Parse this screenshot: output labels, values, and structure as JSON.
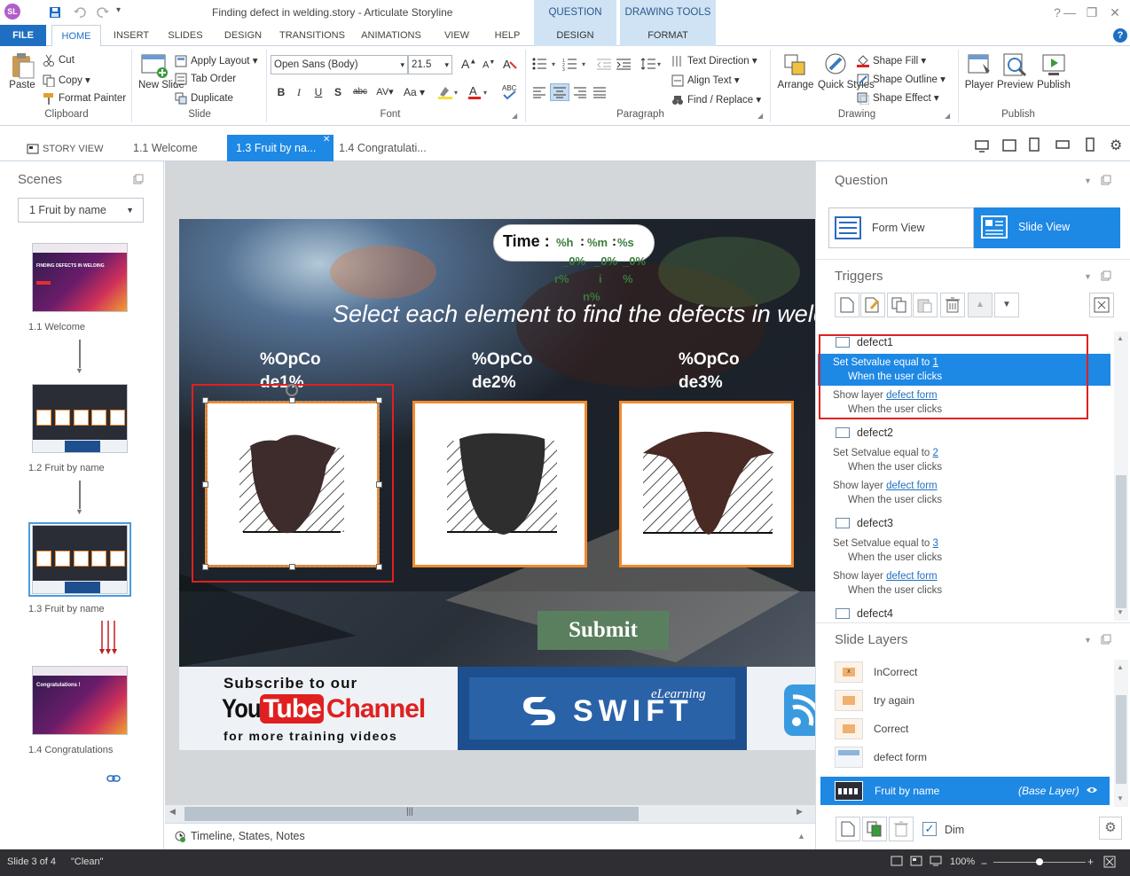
{
  "window": {
    "logo": "SL",
    "title": "Finding defect in welding.story - Articulate Storyline",
    "context_tabs": [
      "QUESTION TOOLS",
      "DRAWING TOOLS"
    ]
  },
  "ribbon_tabs": [
    "FILE",
    "HOME",
    "INSERT",
    "SLIDES",
    "DESIGN",
    "TRANSITIONS",
    "ANIMATIONS",
    "VIEW",
    "HELP",
    "DESIGN",
    "FORMAT"
  ],
  "clipboard": {
    "paste": "Paste",
    "cut": "Cut",
    "copy": "Copy",
    "format_painter": "Format Painter",
    "label": "Clipboard"
  },
  "slide_group": {
    "new_slide": "New Slide",
    "apply_layout": "Apply Layout",
    "tab_order": "Tab Order",
    "duplicate": "Duplicate",
    "label": "Slide"
  },
  "font_group": {
    "font_name": "Open Sans (Body)",
    "font_size": "21.5",
    "label": "Font"
  },
  "paragraph_group": {
    "text_direction": "Text Direction",
    "align_text": "Align Text",
    "find_replace": "Find / Replace",
    "label": "Paragraph"
  },
  "drawing_group": {
    "arrange": "Arrange",
    "quick_styles": "Quick Styles",
    "shape_fill": "Shape Fill",
    "shape_outline": "Shape Outline",
    "shape_effect": "Shape Effect",
    "label": "Drawing"
  },
  "publish_group": {
    "player": "Player",
    "preview": "Preview",
    "publish": "Publish",
    "label": "Publish"
  },
  "view_tabs": {
    "story_view": "STORY VIEW",
    "tab1": "1.1 Welcome",
    "tab2": "1.3 Fruit by na...",
    "tab3": "1.4 Congratulati..."
  },
  "scenes": {
    "title": "Scenes",
    "dropdown": "1 Fruit by name",
    "slides": [
      "1.1 Welcome",
      "1.2 Fruit by name",
      "1.3 Fruit by name",
      "1.4 Congratulations"
    ],
    "thumb1_title": "FINDING DEFECTS IN WELDING",
    "thumb4_title": "Congratulations !"
  },
  "slide": {
    "timer": "Time :",
    "timer_var": "%h",
    "timer_var2": "%m",
    "timer_var3": "%s",
    "timer_frag1": "_0%",
    "timer_frag2": "_0%",
    "timer_frag3": "_0%",
    "timer_frag4": "r%",
    "timer_frag5": "i",
    "timer_frag6": "%",
    "timer_frag7": "n%",
    "instruction": "Select each element to find the defects in welding",
    "labels": [
      "%OpCo de1%",
      "%OpCo de2%",
      "%OpCo de3%"
    ],
    "submit": "Submit",
    "banner_subscribe": "Subscribe to our",
    "banner_you": "You",
    "banner_tube": "Tube",
    "banner_channel": "Channel",
    "banner_more": "for more training videos",
    "brand_script": "eLearning",
    "brand": "SWIFT"
  },
  "canvas_bottom": {
    "timeline": "Timeline, States, Notes"
  },
  "question": {
    "title": "Question",
    "form_view": "Form View",
    "slide_view": "Slide View"
  },
  "triggers": {
    "title": "Triggers",
    "groups": [
      {
        "name": "defect1",
        "set_text": "Set Setvalue equal to",
        "set_value": "1",
        "when": "When the user clicks",
        "show_text": "Show layer",
        "layer": "defect form",
        "when2": "When the user clicks"
      },
      {
        "name": "defect2",
        "set_text": "Set Setvalue equal to",
        "set_value": "2",
        "when": "When the user clicks",
        "show_text": "Show layer",
        "layer": "defect form",
        "when2": "When the user clicks"
      },
      {
        "name": "defect3",
        "set_text": "Set Setvalue equal to",
        "set_value": "3",
        "when": "When the user clicks",
        "show_text": "Show layer",
        "layer": "defect form",
        "when2": "When the user clicks"
      }
    ],
    "last": "defect4"
  },
  "slide_layers": {
    "title": "Slide Layers",
    "layers": [
      "InCorrect",
      "try again",
      "Correct",
      "defect form"
    ],
    "base": "Fruit by name",
    "base_tag": "(Base Layer)",
    "dim": "Dim"
  },
  "status": {
    "slide": "Slide 3 of 4",
    "theme": "\"Clean\"",
    "zoom": "100%"
  },
  "colors": {
    "accent": "#1e88e5",
    "file_tab": "#1e6fc2",
    "highlight_red": "#e02020",
    "submit_green": "#5a7f5e",
    "orange_frame": "#f08a30"
  }
}
